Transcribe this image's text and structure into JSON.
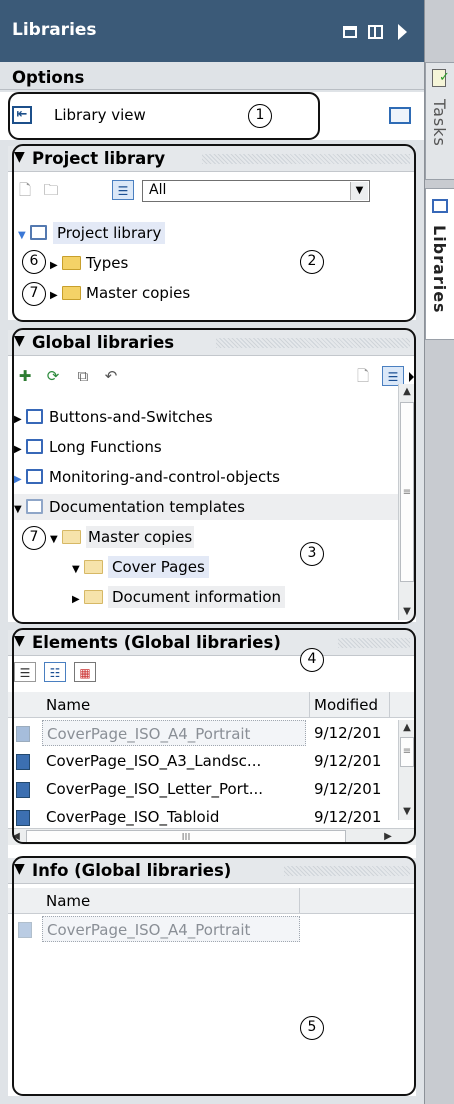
{
  "titlebar": {
    "title": "Libraries"
  },
  "options": {
    "title": "Options",
    "library_view_label": "Library view"
  },
  "side_tabs": [
    {
      "label": "Tasks"
    },
    {
      "label": "Libraries"
    }
  ],
  "project_library": {
    "title": "Project library",
    "filter_value": "All",
    "tree": {
      "root": "Project library",
      "children": [
        "Types",
        "Master copies"
      ]
    }
  },
  "global_libraries": {
    "title": "Global libraries",
    "tree": [
      "Buttons-and-Switches",
      "Long Functions",
      "Monitoring-and-control-objects",
      "Documentation templates",
      "Master copies",
      "Cover Pages",
      "Document information"
    ]
  },
  "elements": {
    "title": "Elements (Global libraries)",
    "columns": [
      "Name",
      "Modified"
    ],
    "rows": [
      {
        "name": "CoverPage_ISO_A4_Portrait",
        "modified": "9/12/201"
      },
      {
        "name": "CoverPage_ISO_A3_Landsc...",
        "modified": "9/12/201"
      },
      {
        "name": "CoverPage_ISO_Letter_Port...",
        "modified": "9/12/201"
      },
      {
        "name": "CoverPage_ISO_Tabloid",
        "modified": "9/12/201"
      }
    ],
    "hscroll_grip": "III"
  },
  "info": {
    "title": "Info (Global libraries)",
    "columns": [
      "Name"
    ],
    "rows": [
      "CoverPage_ISO_A4_Portrait"
    ]
  },
  "callouts": [
    "1",
    "2",
    "3",
    "4",
    "5",
    "6",
    "7",
    "7"
  ],
  "colors": {
    "titlebar": "#3b5a78",
    "panel": "#dfe3e7",
    "selection": "#e3e9f6",
    "folder": "#f4d267"
  }
}
